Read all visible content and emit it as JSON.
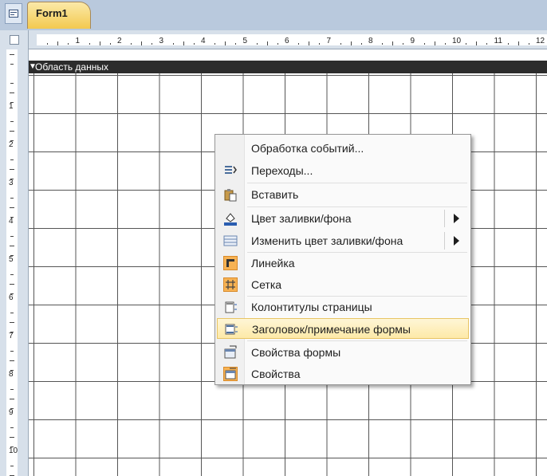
{
  "window": {
    "tab_title": "Form1"
  },
  "ruler": {
    "horizontal_numbers": [
      "1",
      "2",
      "3",
      "4",
      "5",
      "6",
      "7",
      "8",
      "9",
      "10",
      "11",
      "12"
    ],
    "vertical_numbers": [
      "1",
      "2",
      "3",
      "4",
      "5",
      "6",
      "7",
      "8",
      "9",
      "10"
    ]
  },
  "section": {
    "label": "Область данных"
  },
  "context_menu": {
    "items": [
      {
        "label": "Обработка событий...",
        "icon": "none",
        "has_submenu": false
      },
      {
        "label": "Переходы...",
        "icon": "tab-order-icon",
        "has_submenu": false
      },
      {
        "label": "Вставить",
        "icon": "paste-icon",
        "has_submenu": false
      },
      {
        "label": "Цвет заливки/фона",
        "icon": "fill-color-icon",
        "has_submenu": true
      },
      {
        "label": "Изменить цвет заливки/фона",
        "icon": "alternate-fill-icon",
        "has_submenu": true
      },
      {
        "label": "Линейка",
        "icon": "ruler-icon",
        "has_submenu": false,
        "checked": true
      },
      {
        "label": "Сетка",
        "icon": "grid-icon",
        "has_submenu": false,
        "checked": true
      },
      {
        "label": "Колонтитулы страницы",
        "icon": "page-header-footer-icon",
        "has_submenu": false
      },
      {
        "label": "Заголовок/примечание формы",
        "icon": "form-header-footer-icon",
        "has_submenu": false,
        "highlighted": true
      },
      {
        "label": "Свойства формы",
        "icon": "form-properties-icon",
        "has_submenu": false
      },
      {
        "label": "Свойства",
        "icon": "properties-icon",
        "has_submenu": false,
        "checked": true
      }
    ]
  },
  "colors": {
    "accent_tab": "#f3c94f",
    "highlight": "#fde9a8",
    "checked_icon": "#f7b253"
  }
}
